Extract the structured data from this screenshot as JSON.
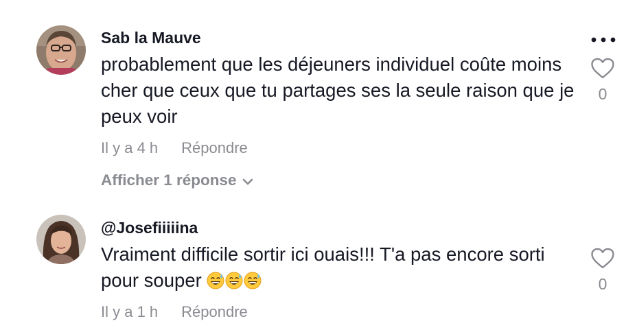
{
  "comments": [
    {
      "username": "Sab la Mauve",
      "text": "probablement que les déjeuners individuel coûte moins cher que ceux que tu partages ses la seule raison que je peux voir",
      "time": "Il y a 4 h",
      "reply_label": "Répondre",
      "view_replies": "Afficher 1 réponse",
      "like_count": "0"
    },
    {
      "username": "@Josefiiiiina",
      "text": "Vraiment difficile sortir ici ouais!!! T'a pas encore sorti pour souper",
      "emojis": [
        "grinning-sweat-emoji",
        "grinning-sweat-emoji",
        "grinning-sweat-emoji"
      ],
      "time": "Il y a 1 h",
      "reply_label": "Répondre",
      "like_count": "0"
    }
  ],
  "icons": {
    "more": "more-options-icon",
    "like": "heart-outline-icon",
    "chevron": "chevron-down-icon"
  },
  "colors": {
    "text": "#161823",
    "muted": "#8a8b91",
    "icon": "#161823",
    "heart_stroke": "#8a8b91"
  }
}
